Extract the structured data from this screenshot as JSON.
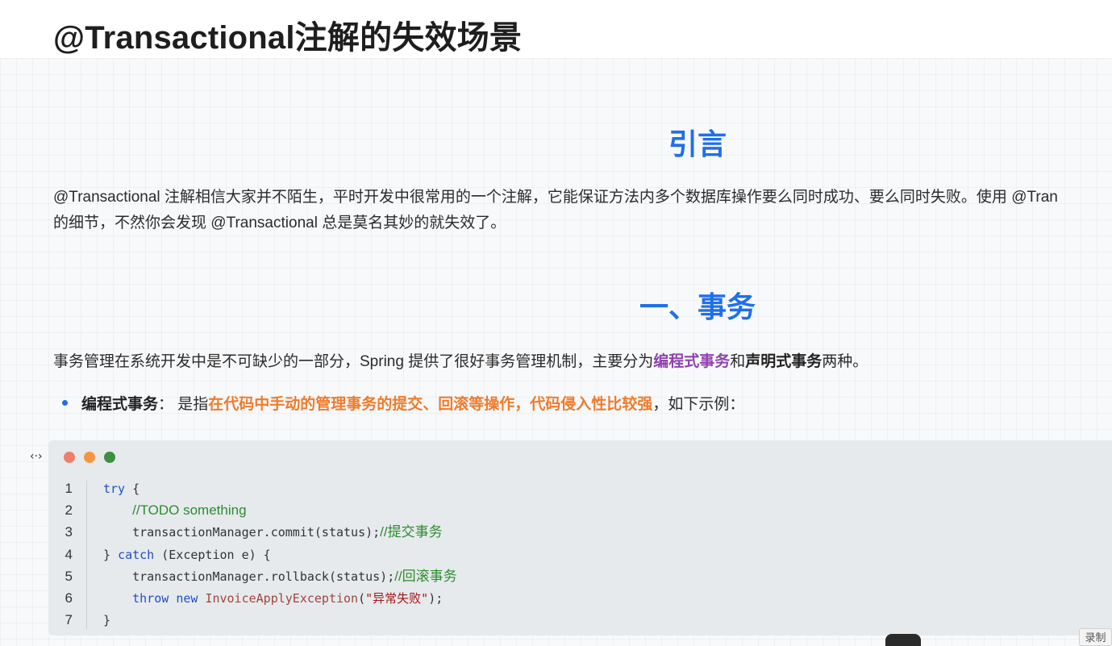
{
  "article": {
    "title": "@Transactional注解的失效场景",
    "intro_heading": "引言",
    "intro_para_line1": "@Transactional 注解相信大家并不陌生，平时开发中很常用的一个注解，它能保证方法内多个数据库操作要么同时成功、要么同时失败。使用 @Tran",
    "intro_para_line2": "的细节，不然你会发现 @Transactional 总是莫名其妙的就失效了。",
    "section1_heading": "一、事务",
    "section1_para": {
      "part1": "事务管理在系统开发中是不可缺少的一部分，Spring 提供了很好事务管理机制，主要分为",
      "programmatic": "编程式事务",
      "and": "和",
      "declarative": "声明式事务",
      "end": "两种。"
    },
    "bullet": {
      "term": "编程式事务",
      "sep": "： 是指",
      "highlight": "在代码中手动的管理事务的提交、回滚等操作，代码侵入性比较强",
      "tail": "，如下示例："
    }
  },
  "code_block": {
    "expand_icon": "expand-horizontal-icon",
    "line_numbers": [
      "1",
      "2",
      "3",
      "4",
      "5",
      "6",
      "7"
    ],
    "tokens": {
      "try": "try",
      "brace_open": " {",
      "todo_comment": "//TODO something",
      "commit_call": "transactionManager.commit(status);",
      "commit_comment": "//提交事务",
      "close_catch": "} ",
      "catch": "catch",
      "catch_args": " (Exception e) {",
      "rollback_call": "transactionManager.rollback(status);",
      "rollback_comment": "//回滚事务",
      "throw": "throw",
      "new": "new",
      "exc_class": "InvoiceApplyException",
      "paren_open": "(",
      "exc_msg": "\"异常失败\"",
      "paren_close": ");",
      "brace_close": "}"
    }
  },
  "overlay": {
    "record_label": "录制"
  },
  "colors": {
    "heading_blue": "#1f6feb",
    "purple_emphasis": "#8e44ad",
    "orange_emphasis": "#ef7b2b",
    "code_bg": "#e6eaed",
    "mac_dot_red": "#f07e6c",
    "mac_dot_orange": "#f5963f",
    "mac_dot_green": "#3b9140"
  }
}
